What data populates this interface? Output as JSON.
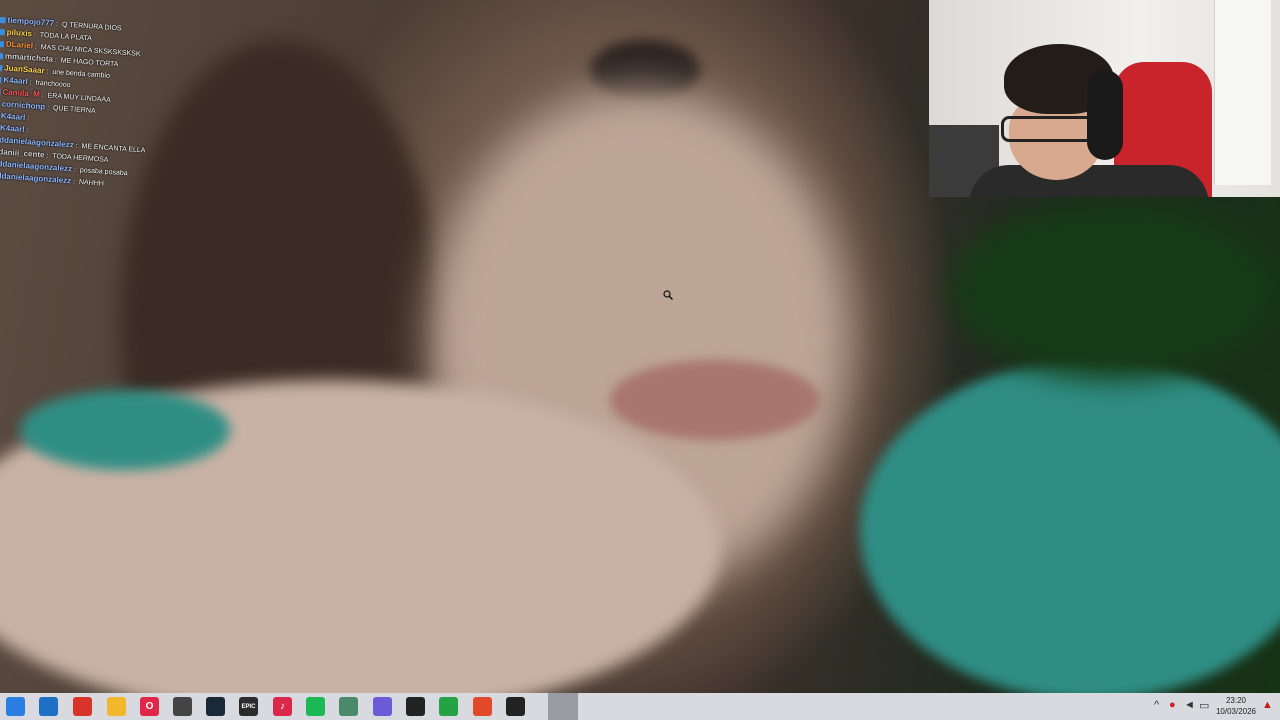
{
  "chat": {
    "messages": [
      {
        "user": "tiempojo777",
        "color": "#8fb8ff",
        "text": "Q TERNURA DIOS"
      },
      {
        "user": "piluxis",
        "color": "#ffd34d",
        "text": "TODA LA PLATA"
      },
      {
        "user": "DLariel",
        "color": "#ff9a3c",
        "text": "MAS CHU MICA SKSKSKSKSK"
      },
      {
        "user": "mmartichota",
        "color": "#cfcfcf",
        "text": "ME HAGO TORTA"
      },
      {
        "user": "JuanSaaar",
        "color": "#ffd34d",
        "text": "une benda cambio"
      },
      {
        "user": "K4aarl",
        "color": "#8fb8ff",
        "text": "franchoooo"
      },
      {
        "user": "Camila_M",
        "color": "#ff5a5a",
        "text": "ERA MUY LINDAAA"
      },
      {
        "user": "cornichonp",
        "color": "#8fb8ff",
        "text": "QUE TIERNA"
      },
      {
        "user": "K4aarl",
        "color": "#8fb8ff",
        "text": ""
      },
      {
        "user": "K4aarl",
        "color": "#8fb8ff",
        "text": ""
      },
      {
        "user": "ddanielaagonzalezz",
        "color": "#8fb8ff",
        "text": "ME ENCANTA ELLA"
      },
      {
        "user": "daniii_cente",
        "color": "#cfcfcf",
        "text": "TODA HERMOSA"
      },
      {
        "user": "ddanielaagonzalezz",
        "color": "#8fb8ff",
        "text": "posaba posaba"
      },
      {
        "user": "ddanielaagonzalezz",
        "color": "#8fb8ff",
        "text": "NAHHH"
      }
    ]
  },
  "taskbar": {
    "icons": [
      {
        "name": "start-icon",
        "color": "#2a7de1",
        "glyph": ""
      },
      {
        "name": "microsoft-store-icon",
        "color": "#1f6fc4",
        "glyph": ""
      },
      {
        "name": "chrome-icon",
        "color": "#d9342b",
        "glyph": ""
      },
      {
        "name": "file-explorer-icon",
        "color": "#f2b72c",
        "glyph": ""
      },
      {
        "name": "opera-icon",
        "color": "#e0274a",
        "glyph": "O"
      },
      {
        "name": "game-app-icon",
        "color": "#444444",
        "glyph": ""
      },
      {
        "name": "steam-icon",
        "color": "#1b2838",
        "glyph": ""
      },
      {
        "name": "epic-games-icon",
        "color": "#2b2b2b",
        "glyph": "EPIC"
      },
      {
        "name": "tiktok-icon",
        "color": "#d9284a",
        "glyph": "♪"
      },
      {
        "name": "spotify-icon",
        "color": "#1db954",
        "glyph": ""
      },
      {
        "name": "app-window-icon",
        "color": "#4a8a6a",
        "glyph": ""
      },
      {
        "name": "messenger-icon",
        "color": "#6b5bd6",
        "glyph": ""
      },
      {
        "name": "capcut-icon",
        "color": "#222222",
        "glyph": ""
      },
      {
        "name": "whatsapp-icon",
        "color": "#25a244",
        "glyph": ""
      },
      {
        "name": "streaming-app-icon",
        "color": "#e04a2a",
        "glyph": ""
      },
      {
        "name": "capcut-icon-2",
        "color": "#222222",
        "glyph": ""
      },
      {
        "name": "active-window-icon",
        "color": "#9a9ca3",
        "glyph": ""
      }
    ],
    "tray": {
      "chevron": "^",
      "time": "23:20",
      "date": "10/03/2026"
    }
  }
}
